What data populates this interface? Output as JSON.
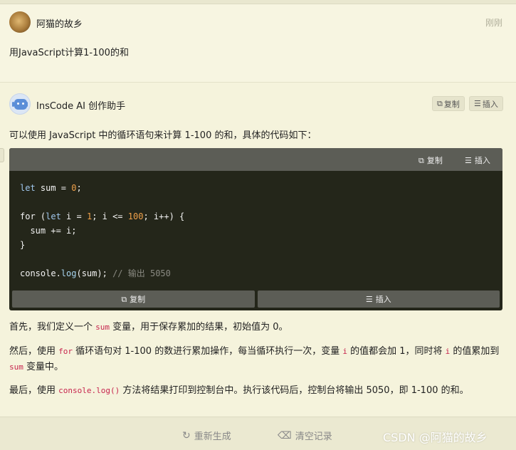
{
  "user": {
    "name": "阿猫的故乡",
    "time": "刚刚",
    "message": "用JavaScript计算1-100的和"
  },
  "bot": {
    "name": "InsCode AI 创作助手",
    "copy_label": "复制",
    "insert_label": "插入"
  },
  "answer": {
    "intro": "可以使用 JavaScript 中的循环语句来计算 1-100 的和，具体的代码如下：",
    "code_header": {
      "copy": "复制",
      "insert": "插入"
    },
    "code_footer": {
      "copy": "复制",
      "insert": "插入"
    },
    "p1": {
      "a": "首先，我们定义一个 ",
      "c1": "sum",
      "b": " 变量，用于保存累加的结果，初始值为 0。"
    },
    "p2": {
      "a": "然后，使用 ",
      "c1": "for",
      "b": " 循环语句对 1-100 的数进行累加操作，每当循环执行一次，变量 ",
      "c2": "i",
      "c": " 的值都会加 1，同时将 ",
      "c3": "i",
      "d": " 的值累加到 ",
      "c4": "sum",
      "e": " 变量中。"
    },
    "p3": {
      "a": "最后，使用 ",
      "c1": "console.log()",
      "b": " 方法将结果打印到控制台中。执行该代码后，控制台将输出 5050，即 1-100 的和。"
    }
  },
  "code_lines": {
    "l1": {
      "kw": "let",
      "rest": " sum = ",
      "num": "0",
      "end": ";"
    },
    "l2": {
      "kw": "for",
      "p1": " (",
      "kw2": "let",
      "p2": " i = ",
      "num1": "1",
      "p3": "; i <= ",
      "num2": "100",
      "p4": "; i++) {"
    },
    "l3": "  sum += i;",
    "l4": "}",
    "l5": {
      "obj": "console.",
      "fn": "log",
      "args": "(sum);",
      "cm": " // 输出 5050"
    }
  },
  "footer": {
    "regenerate": "重新生成",
    "clear": "清空记录"
  },
  "watermark": "CSDN @阿猫的故乡",
  "icons": {
    "copy": "copy-icon",
    "insert": "insert-icon",
    "regenerate": "refresh-icon",
    "clear": "eraser-icon"
  }
}
